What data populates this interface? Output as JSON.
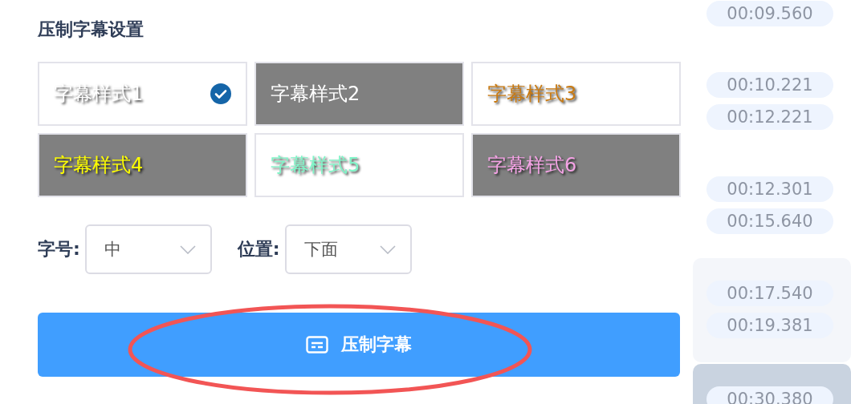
{
  "panel": {
    "title": "压制字幕设置",
    "styles": [
      {
        "label": "字幕样式1",
        "color": "#ffffff",
        "kind": "light",
        "selected": true
      },
      {
        "label": "字幕样式2",
        "color": "#ffffff",
        "kind": "dark",
        "selected": false
      },
      {
        "label": "字幕样式3",
        "color": "#c97a12",
        "kind": "light",
        "selected": false
      },
      {
        "label": "字幕样式4",
        "color": "#ffff00",
        "kind": "dark",
        "selected": false
      },
      {
        "label": "字幕样式5",
        "color": "#80f5c8",
        "kind": "light",
        "selected": false
      },
      {
        "label": "字幕样式6",
        "color": "#f5a3e6",
        "kind": "dark",
        "selected": false
      }
    ],
    "selects": [
      {
        "label": "字号:",
        "value": "中"
      },
      {
        "label": "位置:",
        "value": "下面"
      }
    ],
    "button": {
      "label": "压制字幕"
    }
  },
  "timeline": [
    {
      "kind": "plain",
      "times": [
        "00:09.560"
      ]
    },
    {
      "kind": "plain",
      "times": [
        "00:10.221",
        "00:12.221"
      ]
    },
    {
      "kind": "plain",
      "times": [
        "00:12.301",
        "00:15.640"
      ]
    },
    {
      "kind": "hover",
      "times": [
        "00:17.540",
        "00:19.381"
      ]
    },
    {
      "kind": "active",
      "times": [
        "00:30.380"
      ]
    }
  ]
}
